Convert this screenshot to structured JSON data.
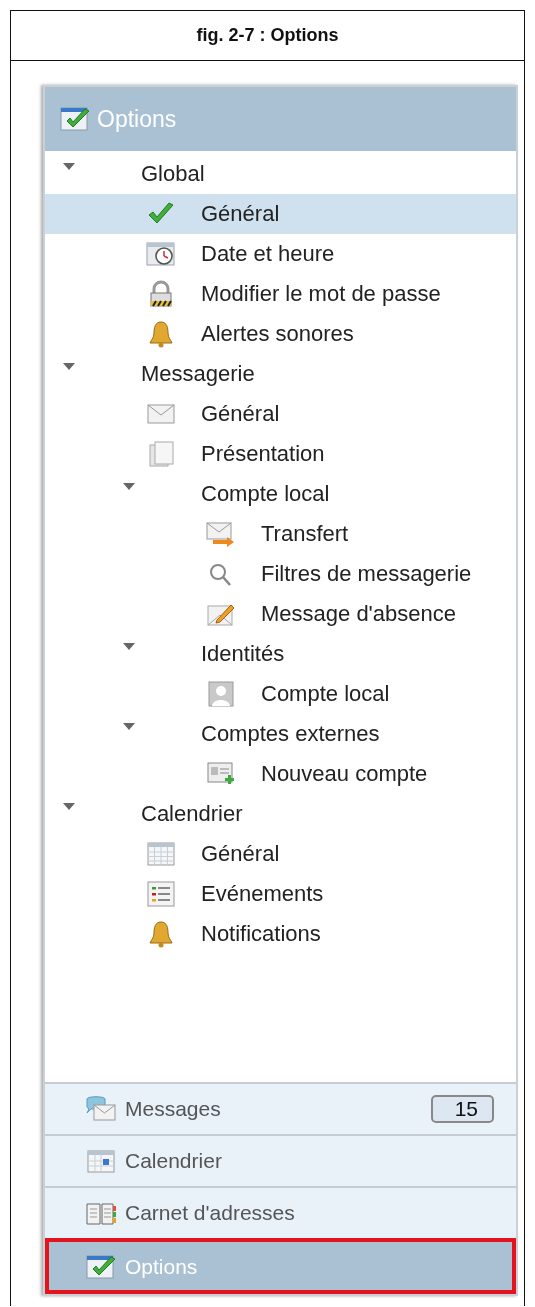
{
  "caption": "fig. 2-7 : Options",
  "panel_header": {
    "title": "Options"
  },
  "tree": [
    {
      "kind": "group",
      "label": "Global",
      "expanded": true,
      "selected": false,
      "children": [
        {
          "kind": "check",
          "label": "Général",
          "selected": true
        },
        {
          "kind": "clock",
          "label": "Date et heure",
          "selected": false
        },
        {
          "kind": "lock",
          "label": "Modifier le mot de passe",
          "selected": false
        },
        {
          "kind": "bell",
          "label": "Alertes sonores",
          "selected": false
        }
      ]
    },
    {
      "kind": "group",
      "label": "Messagerie",
      "expanded": true,
      "selected": false,
      "children": [
        {
          "kind": "envelope",
          "label": "Général",
          "selected": false
        },
        {
          "kind": "pages",
          "label": "Présentation",
          "selected": false
        },
        {
          "kind": "group",
          "label": "Compte local",
          "expanded": true,
          "selected": false,
          "children": [
            {
              "kind": "forward",
              "label": "Transfert",
              "selected": false
            },
            {
              "kind": "search",
              "label": "Filtres de messagerie",
              "selected": false
            },
            {
              "kind": "edit",
              "label": "Message d'absence",
              "selected": false
            }
          ]
        },
        {
          "kind": "group",
          "label": "Identités",
          "expanded": true,
          "selected": false,
          "children": [
            {
              "kind": "person",
              "label": "Compte local",
              "selected": false
            }
          ]
        },
        {
          "kind": "group",
          "label": "Comptes externes",
          "expanded": true,
          "selected": false,
          "children": [
            {
              "kind": "card",
              "label": "Nouveau compte",
              "selected": false
            }
          ]
        }
      ]
    },
    {
      "kind": "group",
      "label": "Calendrier",
      "expanded": true,
      "selected": false,
      "children": [
        {
          "kind": "calendar",
          "label": "Général",
          "selected": false
        },
        {
          "kind": "list",
          "label": "Evénements",
          "selected": false
        },
        {
          "kind": "bell",
          "label": "Notifications",
          "selected": false
        }
      ]
    }
  ],
  "nav": [
    {
      "kind": "chat",
      "label": "Messages",
      "badge": "15",
      "selected": false,
      "outlined": false
    },
    {
      "kind": "calendar-day",
      "label": "Calendrier",
      "selected": false,
      "outlined": false
    },
    {
      "kind": "book",
      "label": "Carnet d'adresses",
      "selected": false,
      "outlined": false
    },
    {
      "kind": "options",
      "label": "Options",
      "selected": true,
      "outlined": true
    }
  ]
}
